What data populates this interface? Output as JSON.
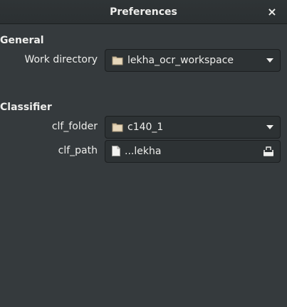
{
  "window": {
    "title": "Preferences",
    "close_glyph": "×"
  },
  "sections": {
    "general": {
      "title": "General",
      "work_directory": {
        "label": "Work directory",
        "value": "lekha_ocr_workspace",
        "icon": "folder-icon"
      }
    },
    "classifier": {
      "title": "Classifier",
      "clf_folder": {
        "label": "clf_folder",
        "value": "c140_1",
        "icon": "folder-icon"
      },
      "clf_path": {
        "label": "clf_path",
        "value": "...lekha",
        "icon": "document-icon",
        "action_icon": "open-file-icon"
      }
    }
  },
  "colors": {
    "background": "#353a3d",
    "headerbar": "#2b3032",
    "field_bg": "#2d3234",
    "folder": "#d9c8a8"
  }
}
